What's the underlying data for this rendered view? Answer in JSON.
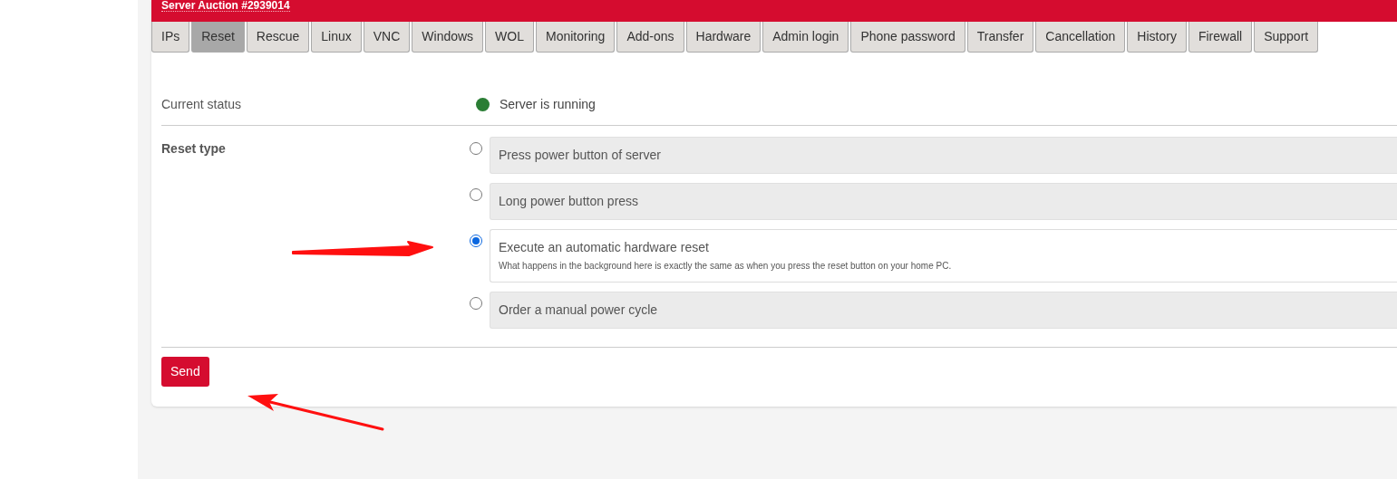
{
  "panel": {
    "title": "Server Auction #2939014"
  },
  "tabs": [
    {
      "label": "IPs",
      "selected": false
    },
    {
      "label": "Reset",
      "selected": true
    },
    {
      "label": "Rescue",
      "selected": false
    },
    {
      "label": "Linux",
      "selected": false
    },
    {
      "label": "VNC",
      "selected": false
    },
    {
      "label": "Windows",
      "selected": false
    },
    {
      "label": "WOL",
      "selected": false
    },
    {
      "label": "Monitoring",
      "selected": false
    },
    {
      "label": "Add-ons",
      "selected": false
    },
    {
      "label": "Hardware",
      "selected": false
    },
    {
      "label": "Admin login",
      "selected": false
    },
    {
      "label": "Phone password",
      "selected": false
    },
    {
      "label": "Transfer",
      "selected": false
    },
    {
      "label": "Cancellation",
      "selected": false
    },
    {
      "label": "History",
      "selected": false
    },
    {
      "label": "Firewall",
      "selected": false
    },
    {
      "label": "Support",
      "selected": false
    }
  ],
  "status": {
    "label": "Current status",
    "value": "Server is running",
    "color": "#2a7d34"
  },
  "reset_type": {
    "label": "Reset type",
    "options": [
      {
        "label": "Press power button of server",
        "selected": false
      },
      {
        "label": "Long power button press",
        "selected": false
      },
      {
        "label": "Execute an automatic hardware reset",
        "description": "What happens in the background here is exactly the same as when you press the reset button on your home PC.",
        "selected": true
      },
      {
        "label": "Order a manual power cycle",
        "selected": false
      }
    ]
  },
  "send_button": "Send"
}
